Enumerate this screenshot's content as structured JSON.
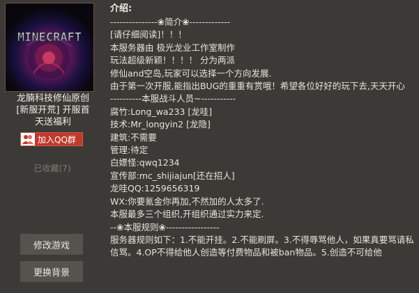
{
  "server": {
    "cover_logo": "MINECRAFT",
    "name_lines": [
      "龙腩科技修仙原创",
      "[新服开荒] 开服首",
      "天送福利"
    ],
    "qq_button": "加入QQ群",
    "favorited": "已收藏(7)",
    "edit_game": "修改游戏",
    "change_bg": "更换背景"
  },
  "intro": {
    "label": "介绍:",
    "lines": [
      "---------------❀简介❀-------------",
      "[请仔细阅读]！！！",
      "本服务器由 极光龙业工作室制作",
      "玩法超级新颖！！！！ 分为两派",
      "修仙and空岛,玩家可以选择一个方向发展.",
      "由于第一次开服,能指出BUG的重重有赏哦！希望各位好好的玩下去,天天开心",
      "----------本服战斗人员~-----------",
      "腐竹:Long_wa233 [龙哇]",
      "技术:Mr_longyin2 [龙隐]",
      "建筑:不需要",
      "管理:待定",
      "白嫖怪:qwq1234",
      "宣传部:mc_shijiajun[还在招人]",
      "龙哇QQ:1259656319",
      "WX:你要氪金你再加,不然加的人太多了.",
      "本服最多三个组织,开组织通过实力来定.",
      "--❀本服规则❀-----------------",
      "服务器规则如下：1.不能开挂。2.不能刷屏。3.不得辱骂他人，如果真要骂请私信骂。4.OP不得给他人创造等付费物品和被ban物品。5.创造不可给他"
    ]
  }
}
